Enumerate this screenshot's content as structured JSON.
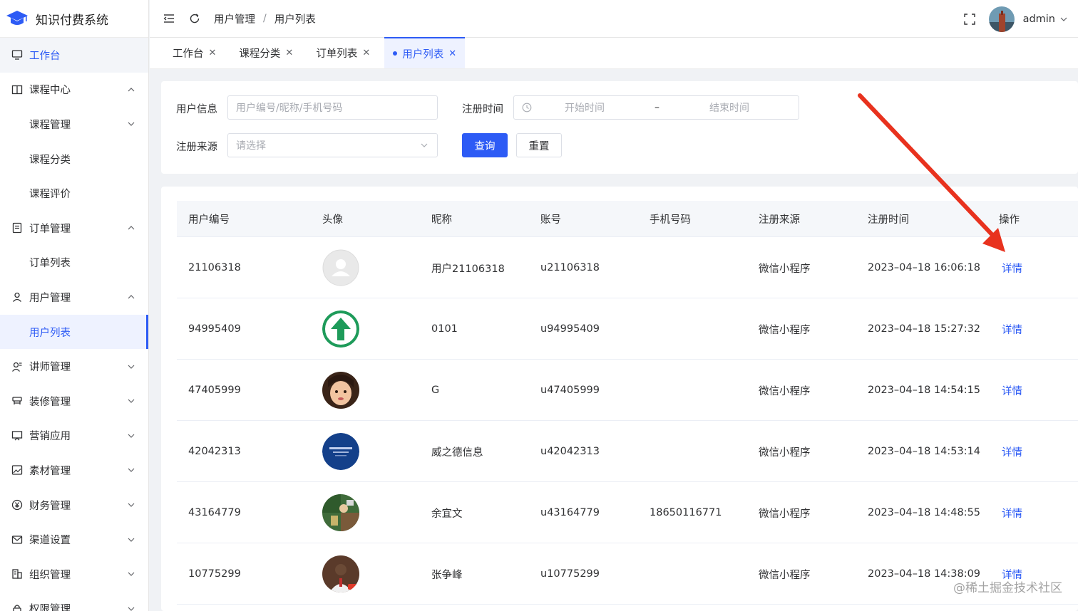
{
  "app": {
    "title": "知识付费系统"
  },
  "sidebar": {
    "items": [
      {
        "label": "工作台",
        "icon": "monitor-icon"
      },
      {
        "label": "课程中心",
        "icon": "book-icon"
      },
      {
        "label": "课程管理"
      },
      {
        "label": "课程分类"
      },
      {
        "label": "课程评价"
      },
      {
        "label": "订单管理",
        "icon": "order-icon"
      },
      {
        "label": "订单列表"
      },
      {
        "label": "用户管理",
        "icon": "user-icon"
      },
      {
        "label": "用户列表"
      },
      {
        "label": "讲师管理",
        "icon": "teacher-icon"
      },
      {
        "label": "装修管理",
        "icon": "decoration-icon"
      },
      {
        "label": "营销应用",
        "icon": "marketing-icon"
      },
      {
        "label": "素材管理",
        "icon": "image-icon"
      },
      {
        "label": "财务管理",
        "icon": "yen-icon"
      },
      {
        "label": "渠道设置",
        "icon": "mail-icon"
      },
      {
        "label": "组织管理",
        "icon": "building-icon"
      },
      {
        "label": "权限管理",
        "icon": "lock-icon"
      }
    ]
  },
  "header": {
    "breadcrumb": [
      "用户管理",
      "用户列表"
    ],
    "separator": "/",
    "username": "admin"
  },
  "tabs": [
    {
      "label": "工作台"
    },
    {
      "label": "课程分类"
    },
    {
      "label": "订单列表"
    },
    {
      "label": "用户列表"
    }
  ],
  "filter": {
    "user_info_label": "用户信息",
    "user_info_placeholder": "用户编号/昵称/手机号码",
    "reg_time_label": "注册时间",
    "start_placeholder": "开始时间",
    "range_sep": "–",
    "end_placeholder": "结束时间",
    "source_label": "注册来源",
    "source_placeholder": "请选择",
    "query_button": "查询",
    "reset_button": "重置"
  },
  "table": {
    "columns": [
      "用户编号",
      "头像",
      "昵称",
      "账号",
      "手机号码",
      "注册来源",
      "注册时间",
      "操作"
    ],
    "rows": [
      {
        "id": "21106318",
        "nickname": "用户21106318",
        "account": "u21106318",
        "phone": "",
        "source": "微信小程序",
        "time": "2023–04–18 16:06:18",
        "action": "详情"
      },
      {
        "id": "94995409",
        "nickname": "0101",
        "account": "u94995409",
        "phone": "",
        "source": "微信小程序",
        "time": "2023–04–18 15:27:32",
        "action": "详情"
      },
      {
        "id": "47405999",
        "nickname": "G",
        "account": "u47405999",
        "phone": "",
        "source": "微信小程序",
        "time": "2023–04–18 14:54:15",
        "action": "详情"
      },
      {
        "id": "42042313",
        "nickname": "威之德信息",
        "account": "u42042313",
        "phone": "",
        "source": "微信小程序",
        "time": "2023–04–18 14:53:14",
        "action": "详情"
      },
      {
        "id": "43164779",
        "nickname": "余宜文",
        "account": "u43164779",
        "phone": "18650116771",
        "source": "微信小程序",
        "time": "2023–04–18 14:48:55",
        "action": "详情"
      },
      {
        "id": "10775299",
        "nickname": "张争峰",
        "account": "u10775299",
        "phone": "",
        "source": "微信小程序",
        "time": "2023–04–18 14:38:09",
        "action": "详情"
      }
    ]
  },
  "watermark": "@稀土掘金技术社区",
  "colors": {
    "primary": "#2d5bf5",
    "annotation_arrow": "#e8321e"
  }
}
